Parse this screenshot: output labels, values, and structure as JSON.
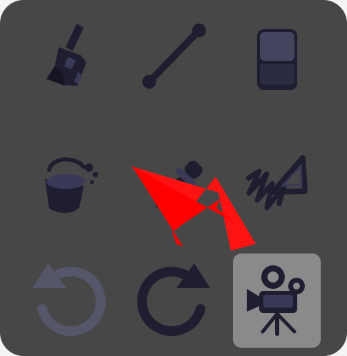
{
  "panel": {
    "tools": [
      {
        "id": "paint-brush",
        "icon": "paint-brush-icon",
        "selected": false,
        "enabled": true
      },
      {
        "id": "line",
        "icon": "line-icon",
        "selected": false,
        "enabled": true
      },
      {
        "id": "eraser",
        "icon": "eraser-icon",
        "selected": false,
        "enabled": true
      },
      {
        "id": "fill",
        "icon": "paint-bucket-icon",
        "selected": false,
        "enabled": true
      },
      {
        "id": "eyedropper",
        "icon": "eyedropper-icon",
        "selected": false,
        "enabled": true
      },
      {
        "id": "scribble-triangle",
        "icon": "scribble-triangle-icon",
        "selected": false,
        "enabled": true
      },
      {
        "id": "undo",
        "icon": "undo-arrow-icon",
        "selected": false,
        "enabled": false
      },
      {
        "id": "redo",
        "icon": "redo-arrow-icon",
        "selected": false,
        "enabled": true
      },
      {
        "id": "camera",
        "icon": "movie-camera-icon",
        "selected": true,
        "enabled": true
      }
    ]
  },
  "annotation": {
    "icon": "red-arrow-pointer",
    "color": "#ff0000"
  },
  "colors": {
    "panel_bg": "#474747",
    "selected_bg": "#8a8a8a",
    "icon_dark": "#1f1e30",
    "icon_mid": "#3a3a58",
    "disabled_icon": "#55566a"
  }
}
